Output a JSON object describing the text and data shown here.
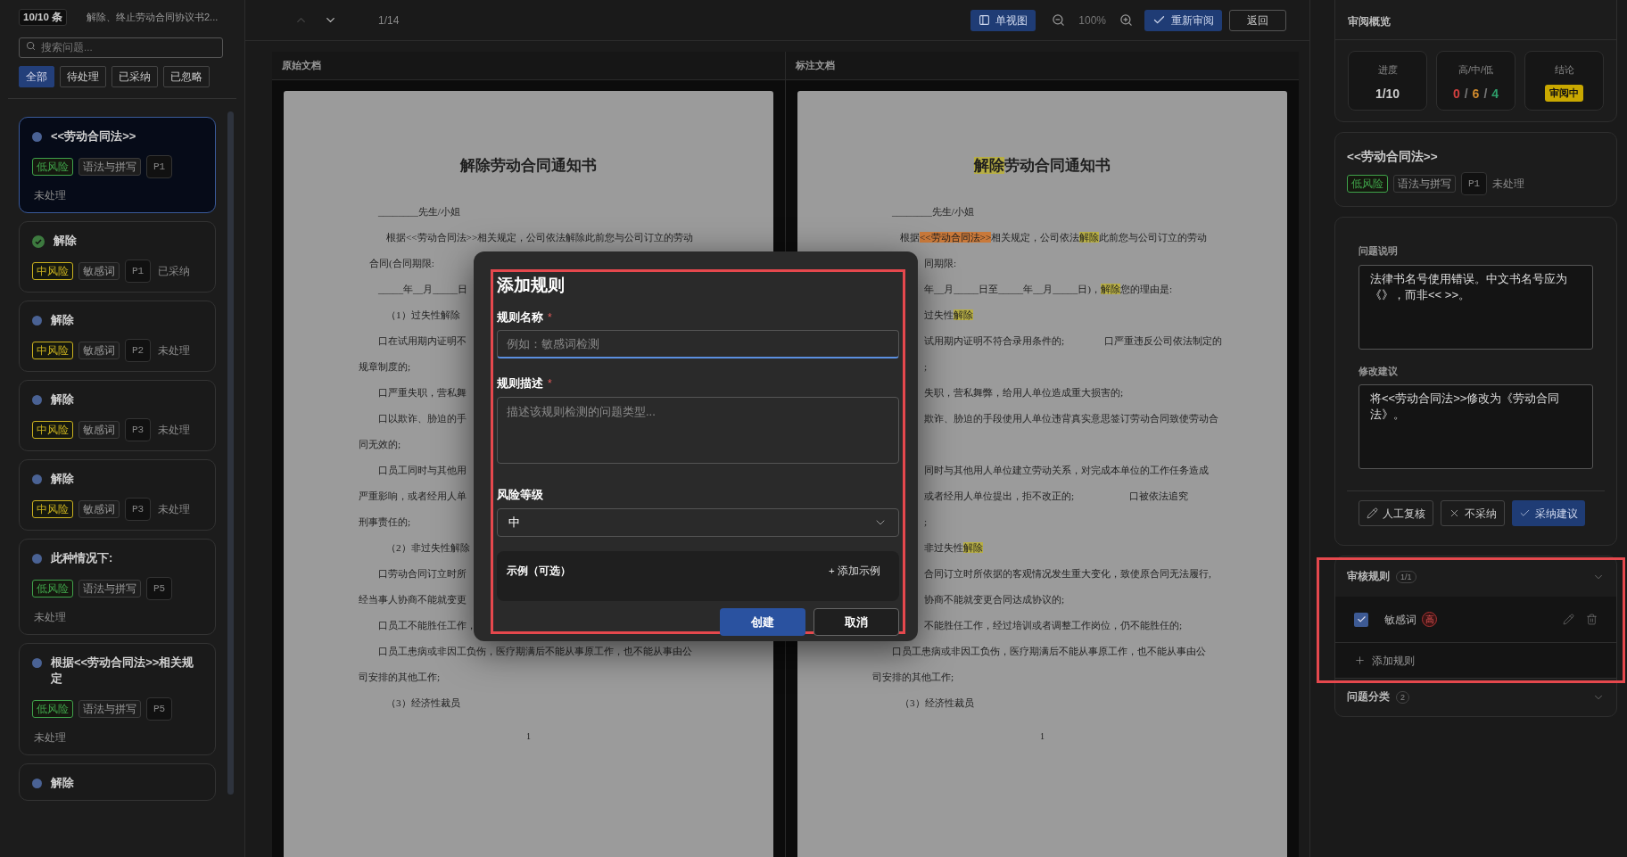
{
  "sidebar": {
    "count": "10/10 条",
    "document_title": "解除、终止劳动合同协议书2...",
    "search": {
      "placeholder": "搜索问题..."
    },
    "filters": [
      {
        "label": "全部",
        "selected": true
      },
      {
        "label": "待处理",
        "selected": false
      },
      {
        "label": "已采纳",
        "selected": false
      },
      {
        "label": "已忽略",
        "selected": false
      }
    ],
    "issues": [
      {
        "title": "<<劳动合同法>>",
        "selected": true,
        "resolved": false,
        "risk": "低风险",
        "color": "#3fa24a",
        "category": "语法与拼写",
        "page": "P1",
        "status": "未处理"
      },
      {
        "title": "解除",
        "selected": false,
        "resolved": true,
        "risk": "中风险",
        "color": "#cbb21f",
        "category": "敏感词",
        "page": "P1",
        "status": "已采纳"
      },
      {
        "title": "解除",
        "selected": false,
        "resolved": false,
        "risk": "中风险",
        "color": "#cbb21f",
        "category": "敏感词",
        "page": "P2",
        "status": "未处理"
      },
      {
        "title": "解除",
        "selected": false,
        "resolved": false,
        "risk": "中风险",
        "color": "#cbb21f",
        "category": "敏感词",
        "page": "P3",
        "status": "未处理"
      },
      {
        "title": "解除",
        "selected": false,
        "resolved": false,
        "risk": "中风险",
        "color": "#cbb21f",
        "category": "敏感词",
        "page": "P3",
        "status": "未处理"
      },
      {
        "title": "此种情况下:",
        "selected": false,
        "resolved": false,
        "risk": "低风险",
        "color": "#3fa24a",
        "category": "语法与拼写",
        "page": "P5",
        "status": "未处理"
      },
      {
        "title": "根据<<劳动合同法>>相关规定",
        "selected": false,
        "resolved": false,
        "risk": "低风险",
        "color": "#3fa24a",
        "category": "语法与拼写",
        "page": "P5",
        "status": "未处理"
      },
      {
        "title": "解除",
        "selected": false,
        "resolved": false
      }
    ]
  },
  "toolbar": {
    "prev": {
      "disabled": true
    },
    "next": {
      "disabled": false
    },
    "position": "1/14",
    "view_button": "单视图",
    "zoom": "100%",
    "recheck_button": "重新审阅",
    "back_button": "返回"
  },
  "documents": [
    {
      "header": "原始文档",
      "title": [
        {
          "text": "解除劳动合同通知书"
        }
      ],
      "page_number": "1",
      "lines": [
        {
          "kind": "para",
          "segments": [
            {
              "text": "________先生/小姐"
            }
          ]
        },
        {
          "kind": "sub",
          "segments": [
            {
              "text": "根据<<劳动合同法>>相关规定，公司依法解除此前您与公司订立的劳动"
            }
          ]
        },
        {
          "kind": "mid",
          "segments": [
            {
              "text": "合同(合同期限:"
            }
          ]
        },
        {
          "kind": "para",
          "segments": [
            {
              "text": "_____年__月_____日"
            }
          ]
        },
        {
          "kind": "sub",
          "segments": [
            {
              "text": "（1）过失性解除"
            }
          ]
        },
        {
          "kind": "para",
          "segments": [
            {
              "text": "口在试用期内证明不"
            }
          ]
        },
        {
          "kind": "cont",
          "segments": [
            {
              "text": "规章制度的;"
            }
          ]
        },
        {
          "kind": "para",
          "segments": [
            {
              "text": "口严重失职，营私舞"
            }
          ]
        },
        {
          "kind": "para",
          "segments": [
            {
              "text": "口以欺诈、胁迫的手"
            }
          ]
        },
        {
          "kind": "cont",
          "segments": [
            {
              "text": "同无效的;"
            }
          ]
        },
        {
          "kind": "para",
          "segments": [
            {
              "text": "口员工同时与其他用"
            }
          ]
        },
        {
          "kind": "cont",
          "segments": [
            {
              "text": "严重影响，或者经用人单"
            }
          ]
        },
        {
          "kind": "cont",
          "segments": [
            {
              "text": "刑事责任的;"
            }
          ]
        },
        {
          "kind": "sub",
          "segments": [
            {
              "text": "（2）非过失性解除"
            }
          ]
        },
        {
          "kind": "para",
          "segments": [
            {
              "text": "口劳动合同订立时所"
            }
          ]
        },
        {
          "kind": "cont",
          "segments": [
            {
              "text": "经当事人协商不能就变更"
            }
          ]
        },
        {
          "kind": "para",
          "segments": [
            {
              "text": "口员工不能胜任工作，"
            }
          ]
        },
        {
          "kind": "para",
          "segments": [
            {
              "text": "口员工患病或非因工负伤，医疗期满后不能从事原工作，也不能从事由公"
            }
          ]
        },
        {
          "kind": "cont",
          "segments": [
            {
              "text": "司安排的其他工作;"
            }
          ]
        },
        {
          "kind": "sub",
          "segments": [
            {
              "text": "（3）经济性裁员"
            }
          ]
        }
      ]
    },
    {
      "header": "标注文档",
      "title": [
        {
          "text": "解除",
          "color": "#b7ae45"
        },
        {
          "text": "劳动合同通知书"
        }
      ],
      "page_number": "1",
      "lines": [
        {
          "kind": "para",
          "segments": [
            {
              "text": "________先生/小姐"
            }
          ]
        },
        {
          "kind": "sub",
          "segments": [
            {
              "text": "根据"
            },
            {
              "text": "<<劳动合同法>>",
              "color": "#c9793a"
            },
            {
              "text": "相关规定，公司依法"
            },
            {
              "text": "解除",
              "color": "#b7ae45"
            },
            {
              "text": "此前您与公司订立的劳动"
            }
          ]
        },
        {
          "kind": "partial",
          "segments": [
            {
              "text": "同期限:"
            }
          ]
        },
        {
          "kind": "partial",
          "segments": [
            {
              "text": "年__月_____日至_____年__月_____日)，"
            },
            {
              "text": "解除",
              "color": "#b7ae45"
            },
            {
              "text": "您的理由是:"
            }
          ]
        },
        {
          "kind": "partial",
          "segments": [
            {
              "text": "过失性"
            },
            {
              "text": "解除",
              "color": "#b7ae45"
            }
          ]
        },
        {
          "kind": "partial",
          "segments": [
            {
              "text": "试用期内证明不符合录用条件的;                口严重违反公司依法制定的"
            }
          ]
        },
        {
          "kind": "partial",
          "segments": [
            {
              "text": ";"
            }
          ]
        },
        {
          "kind": "partial",
          "segments": [
            {
              "text": "失职，营私舞弊，给用人单位造成重大损害的;"
            }
          ]
        },
        {
          "kind": "partial",
          "segments": [
            {
              "text": "欺诈、胁迫的手段使用人单位违背真实意思签订劳动合同致使劳动合"
            }
          ]
        },
        {
          "kind": "partial",
          "gap_before": true,
          "segments": [
            {
              "text": "同时与其他用人单位建立劳动关系，对完成本单位的工作任务造成"
            }
          ]
        },
        {
          "kind": "partial",
          "segments": [
            {
              "text": "或者经用人单位提出，拒不改正的;                      口被依法追究"
            }
          ]
        },
        {
          "kind": "partial",
          "segments": [
            {
              "text": ";"
            }
          ]
        },
        {
          "kind": "partial",
          "segments": [
            {
              "text": "非过失性"
            },
            {
              "text": "解除",
              "color": "#b7ae45"
            }
          ]
        },
        {
          "kind": "partial",
          "segments": [
            {
              "text": "合同订立时所依据的客观情况发生重大变化，致使原合同无法履行,"
            }
          ]
        },
        {
          "kind": "partial",
          "segments": [
            {
              "text": "协商不能就变更合同达成协议的;"
            }
          ]
        },
        {
          "kind": "partial",
          "segments": [
            {
              "text": "不能胜任工作，经过培训或者调整工作岗位，仍不能胜任的;"
            }
          ]
        },
        {
          "kind": "para",
          "segments": [
            {
              "text": "口员工患病或非因工负伤，医疗期满后不能从事原工作，也不能从事由公"
            }
          ]
        },
        {
          "kind": "cont",
          "segments": [
            {
              "text": "司安排的其他工作;"
            }
          ]
        },
        {
          "kind": "sub",
          "segments": [
            {
              "text": "（3）经济性裁员"
            }
          ]
        }
      ]
    }
  ],
  "overview": {
    "title": "审阅概览",
    "stats": [
      {
        "label": "进度",
        "kind": "text",
        "value": "1/10"
      },
      {
        "label": "高/中/低",
        "kind": "counts",
        "separator": "/",
        "counts": [
          {
            "text": "0",
            "color": "#d2403f"
          },
          {
            "text": "6",
            "color": "#d08a2c"
          },
          {
            "text": "4",
            "color": "#2e9e6a"
          }
        ]
      },
      {
        "label": "结论",
        "kind": "badge",
        "value": "审阅中"
      }
    ]
  },
  "current_issue": {
    "title": "<<劳动合同法>>",
    "risk": "低风险",
    "color": "#3fa24a",
    "category": "语法与拼写",
    "page": "P1",
    "status": "未处理"
  },
  "details": {
    "fields": [
      {
        "label": "问题说明",
        "value": "法律书名号使用错误。中文书名号应为《》，而非<< >>。"
      },
      {
        "label": "修改建议",
        "value": "将<<劳动合同法>>修改为《劳动合同法》。"
      }
    ],
    "actions": [
      {
        "label": "人工复核",
        "kind": "edit"
      },
      {
        "label": "不采纳",
        "kind": "reject"
      },
      {
        "label": "采纳建议",
        "kind": "accept"
      }
    ]
  },
  "rules": {
    "title": "审核规则",
    "count": "1/1",
    "highlighted": true,
    "items": [
      {
        "name": "敏感词",
        "checked": true,
        "risk": "高"
      }
    ],
    "add_label": "添加规则"
  },
  "categories": {
    "title": "问题分类",
    "count": "2"
  },
  "dialog": {
    "title": "添加规则",
    "highlighted": true,
    "fields": [
      {
        "kind": "input",
        "label": "规则名称",
        "required_mark": "*",
        "placeholder": "例如：敏感词检测",
        "focused": true
      },
      {
        "kind": "textarea",
        "label": "规则描述",
        "required_mark": "*",
        "placeholder": "描述该规则检测的问题类型..."
      },
      {
        "kind": "select",
        "label": "风险等级",
        "value": "中"
      }
    ],
    "examples": {
      "label": "示例（可选）",
      "add_button": "+ 添加示例"
    },
    "buttons": [
      {
        "label": "创建",
        "primary": true
      },
      {
        "label": "取消",
        "primary": false
      }
    ]
  }
}
